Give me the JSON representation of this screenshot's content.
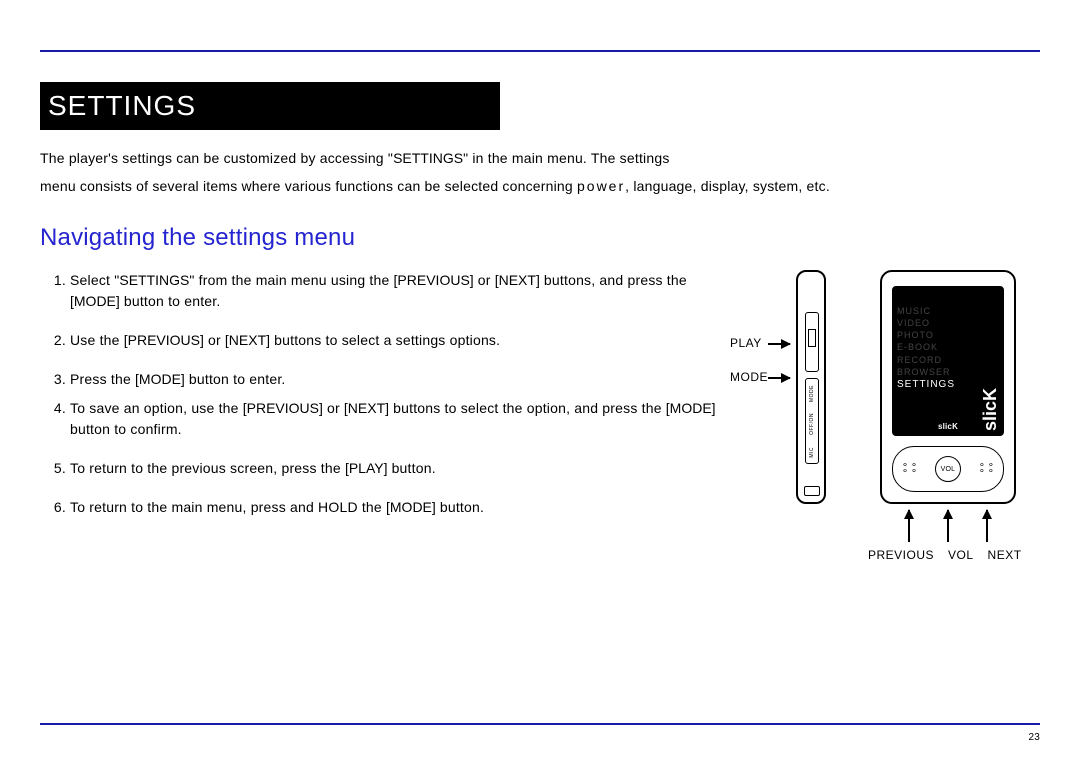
{
  "page_number": "23",
  "section_title": "SETTINGS",
  "intro": {
    "part1": "The player's settings can be customized by accessing \"",
    "kw1": "SETTINGS",
    "part2": "\" in the main menu. The settings",
    "part3": "menu consists of several items where various functions can be selected concerning ",
    "kw2": "power",
    "part4": ", language, display, system, etc."
  },
  "subheading": "Navigating the settings menu",
  "steps": [
    {
      "pre": "Select \"",
      "kw1": "SETTINGS",
      "mid1": "\" from the main menu using the ",
      "btn1": "[PREVIOUS]",
      "mid2": "  or ",
      "btn2": "[NEXT]",
      "mid3": "  buttons, and press the ",
      "btn3": "[MODE]",
      "post": " button to enter."
    },
    {
      "pre": "Use the ",
      "btn1": "[PREVIOUS]",
      "mid1": "  or  ",
      "btn2": "[NEXT]",
      "mid2": "  buttons to select a settings options.",
      "btn3": "",
      "post": ""
    },
    {
      "pre": " Press the ",
      "btn1": "[MODE]",
      "mid1": " button to enter.",
      "btn2": "",
      "mid2": "",
      "btn3": "",
      "post": ""
    },
    {
      "pre": "To save an option, use the ",
      "btn1": "[PREVIOUS]",
      "mid1": " or ",
      "btn2": "[NEXT]",
      "mid2": " buttons to select the option, and press the ",
      "btn3": "[MODE]",
      "post": "  button to confirm."
    },
    {
      "pre": "To return to the previous screen, press the ",
      "btn1": "[PLAY]",
      "mid1": "  button.",
      "btn2": "",
      "mid2": "",
      "btn3": "",
      "post": ""
    },
    {
      "pre": "To return to the main menu, press and HOLD the ",
      "btn1": "[MODE]",
      "mid1": "  button.",
      "btn2": "",
      "mid2": "",
      "btn3": "",
      "post": ""
    }
  ],
  "device": {
    "side_labels": [
      "MODE",
      "OFF/ON",
      "MIC"
    ],
    "callouts": {
      "play": "PLAY",
      "mode": "MODE"
    },
    "menu": [
      "MUSIC",
      "VIDEO",
      "PHOTO",
      "E-BOOK",
      "RECORD",
      "BROWSER",
      "SETTINGS"
    ],
    "menu_selected_index": 6,
    "brand": "slicK",
    "vol": "VOL",
    "bottom_labels": [
      "PREVIOUS",
      "VOL",
      "NEXT"
    ]
  }
}
